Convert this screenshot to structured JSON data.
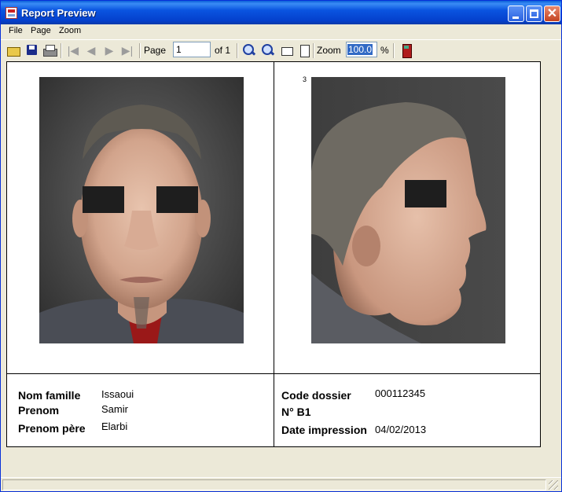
{
  "window": {
    "title": "Report Preview"
  },
  "menu": {
    "items": [
      "File",
      "Page",
      "Zoom"
    ]
  },
  "toolbar": {
    "page_label": "Page",
    "page_value": "1",
    "of_label": "of 1",
    "zoom_label": "Zoom",
    "zoom_value": "100.0",
    "percent_label": "%"
  },
  "report": {
    "left": {
      "rows": [
        {
          "label": "Nom famille",
          "value": "Issaoui"
        },
        {
          "label": "Prenom",
          "value": "Samir"
        },
        {
          "label": "Prenom père",
          "value": "Elarbi"
        }
      ]
    },
    "right": {
      "rows": [
        {
          "label": "Code dossier",
          "value": "000112345"
        },
        {
          "label": "N° B1",
          "value": ""
        },
        {
          "label": "Date impression",
          "value": "04/02/2013"
        }
      ],
      "mark": "3"
    }
  },
  "colors": {
    "titlebar": "#0a54e0",
    "page_bg": "#ffffff",
    "window_bg": "#ece9d8",
    "censor": "#1e1e1e"
  },
  "icons": [
    "app-icon",
    "open-icon",
    "save-icon",
    "print-icon",
    "first-page-icon",
    "prev-page-icon",
    "next-page-icon",
    "last-page-icon",
    "zoom-in-icon",
    "zoom-out-icon",
    "fit-width-icon",
    "fit-page-icon",
    "exit-icon"
  ]
}
